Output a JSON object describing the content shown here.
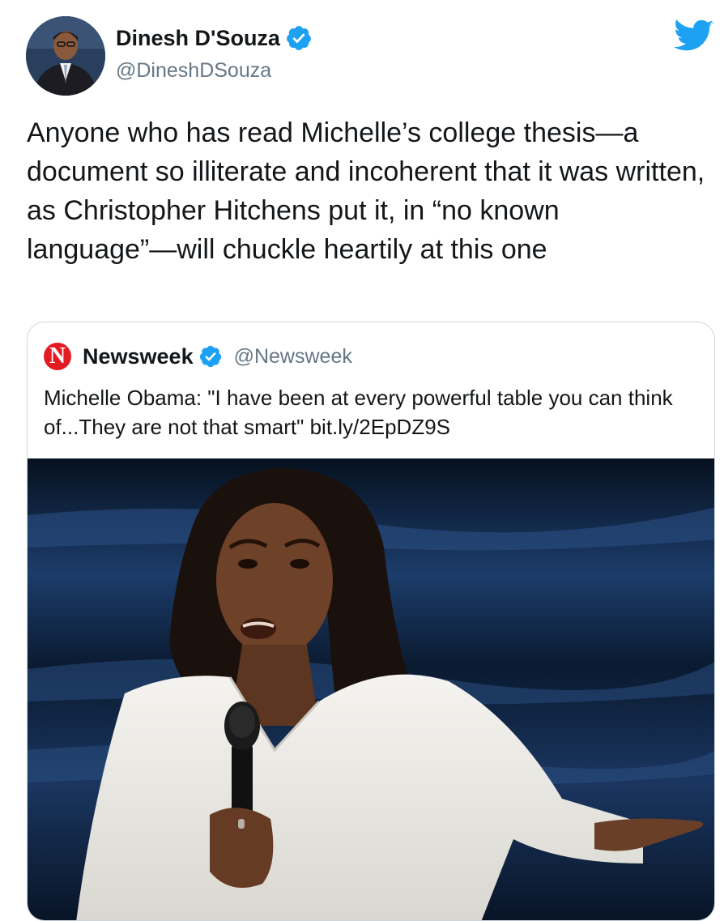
{
  "author": {
    "display_name": "Dinesh D'Souza",
    "handle": "@DineshDSouza",
    "verified_icon": "verified-badge-icon",
    "avatar_icon": "avatar-photo"
  },
  "brand_icon": "twitter-bird-icon",
  "tweet": {
    "text": "Anyone who has read Michelle’s college thesis—a document so illiterate and incoherent that it was written, as Christopher Hitchens put it, in “no known language”—will chuckle heartily at this one"
  },
  "quoted_tweet": {
    "logo_letter": "N",
    "display_name": "Newsweek",
    "handle": "@Newsweek",
    "text": "Michelle Obama: \"I have been at every powerful table you can think of...They are not that smart\" bit.ly/2EpDZ9S",
    "image": "photo of woman in white dress speaking into microphone on stage"
  },
  "colors": {
    "verified_blue": "#1da1f2",
    "twitter_blue": "#1da1f2",
    "text": "#14171a",
    "secondary_text": "#657786",
    "border": "#ccd6dd",
    "newsweek_red": "#e31b23"
  }
}
